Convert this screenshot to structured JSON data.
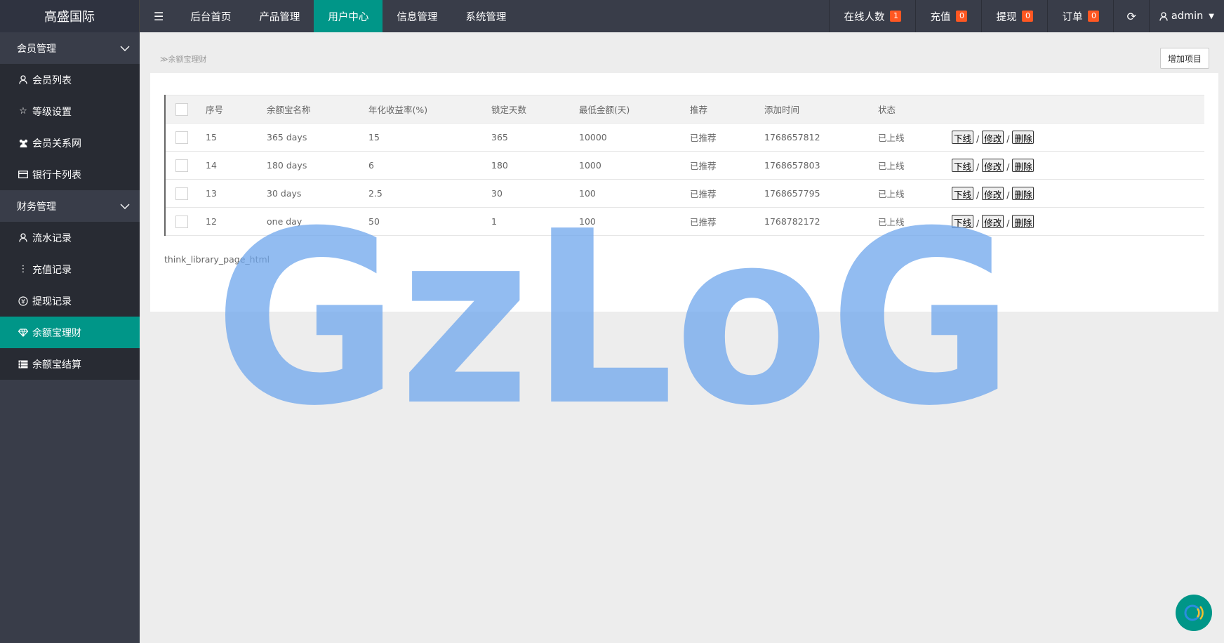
{
  "app": {
    "logo": "高盛国际"
  },
  "topnav": {
    "items": [
      "后台首页",
      "产品管理",
      "用户中心",
      "信息管理",
      "系统管理"
    ],
    "active_index": 2
  },
  "topright": {
    "online_label": "在线人数",
    "online_count": "1",
    "recharge_label": "充值",
    "recharge_count": "0",
    "withdraw_label": "提现",
    "withdraw_count": "0",
    "order_label": "订单",
    "order_count": "0",
    "user_name": "admin"
  },
  "sidebar": {
    "groups": [
      {
        "label": "会员管理",
        "items": [
          {
            "label": "会员列表",
            "icon": "user-icon"
          },
          {
            "label": "等级设置",
            "icon": "star-icon"
          },
          {
            "label": "会员关系网",
            "icon": "group-icon"
          },
          {
            "label": "银行卡列表",
            "icon": "card-icon"
          }
        ]
      },
      {
        "label": "财务管理",
        "items": [
          {
            "label": "流水记录",
            "icon": "user-icon"
          },
          {
            "label": "充值记录",
            "icon": "more-vertical-icon"
          },
          {
            "label": "提现记录",
            "icon": "yen-icon"
          },
          {
            "label": "余额宝理财",
            "icon": "diamond-icon",
            "active": true
          },
          {
            "label": "余额宝结算",
            "icon": "list-icon"
          }
        ]
      }
    ]
  },
  "main": {
    "breadcrumb_text": "≫余额宝理财",
    "add_button": "增加项目",
    "table": {
      "headers": [
        "序号",
        "余额宝名称",
        "年化收益率(%)",
        "锁定天数",
        "最低金额(天)",
        "推荐",
        "添加时间",
        "状态"
      ],
      "rows": [
        [
          "15",
          "365 days",
          "15",
          "365",
          "10000",
          "已推荐",
          "1768657812",
          "已上线"
        ],
        [
          "14",
          "180 days",
          "6",
          "180",
          "1000",
          "已推荐",
          "1768657803",
          "已上线"
        ],
        [
          "13",
          "30 days",
          "2.5",
          "30",
          "100",
          "已推荐",
          "1768657795",
          "已上线"
        ],
        [
          "12",
          "one day",
          "50",
          "1",
          "100",
          "已推荐",
          "1768782172",
          "已上线"
        ]
      ],
      "actions": {
        "offline": "下线",
        "edit": "修改",
        "delete": "删除",
        "separator": "/"
      }
    },
    "pager_text": "think_library_page_html"
  },
  "watermark_text": "GzLoG",
  "colors": {
    "accent": "#009688",
    "topbar": "#393D49",
    "badge": "#FF5722",
    "watermark": "#6ea6ec"
  }
}
